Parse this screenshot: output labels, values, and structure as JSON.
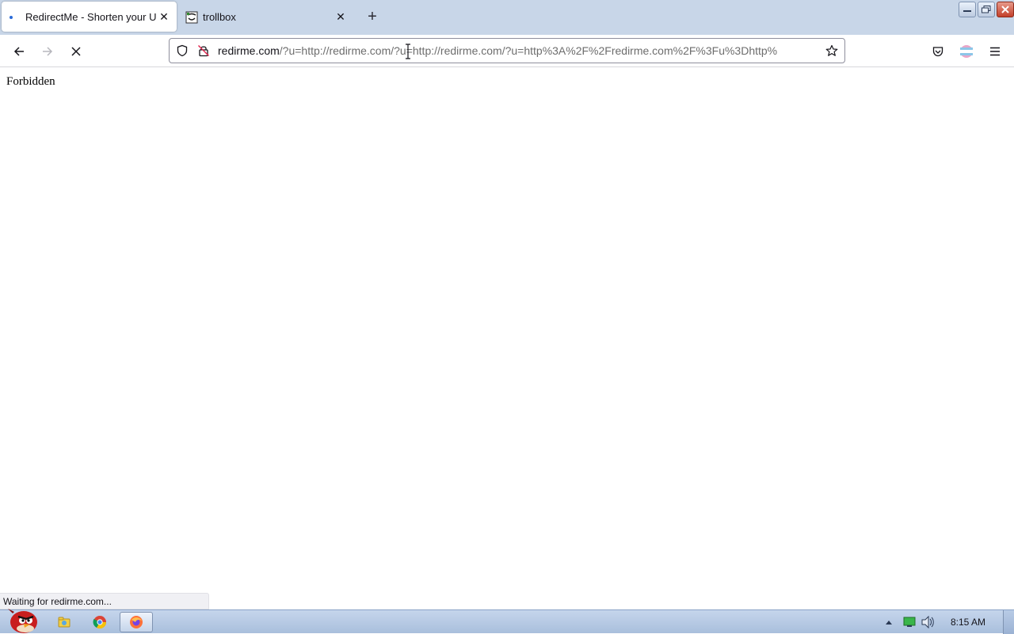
{
  "browser": {
    "tabs": [
      {
        "title": "RedirectMe - Shorten your URL",
        "active": true,
        "loading": true
      },
      {
        "title": "trollbox",
        "active": false,
        "favicon": "trollface-favicon-icon"
      }
    ],
    "new_tab_icon": "plus-icon",
    "close_icon": "close-icon",
    "nav": {
      "back_icon": "arrow-left-icon",
      "forward_icon": "arrow-right-icon",
      "stop_icon": "stop-x-icon"
    },
    "url": {
      "domain": "redirme.com",
      "rest": "/?u=http://redirme.com/?u=http://redirme.com/?u=http%3A%2F%2Fredirme.com%2F%3Fu%3Dhttp%"
    },
    "toolbar_icons": [
      "shield-icon",
      "lock-warning-icon",
      "star-icon",
      "pocket-icon",
      "account-icon",
      "hamburger-menu-icon"
    ]
  },
  "page": {
    "body_text": "Forbidden"
  },
  "status": {
    "text": "Waiting for redirme.com..."
  },
  "taskbar": {
    "clock": "8:15 AM",
    "apps": [
      "file-explorer-icon",
      "chrome-icon",
      "firefox-icon"
    ],
    "tray_icons": [
      "tray-up-arrow-icon",
      "network-icon",
      "volume-icon"
    ]
  },
  "colors": {
    "tabstrip": "#c8d6e8",
    "taskbar": "#a9bfdc",
    "loading_accent": "#2a6bd8"
  }
}
